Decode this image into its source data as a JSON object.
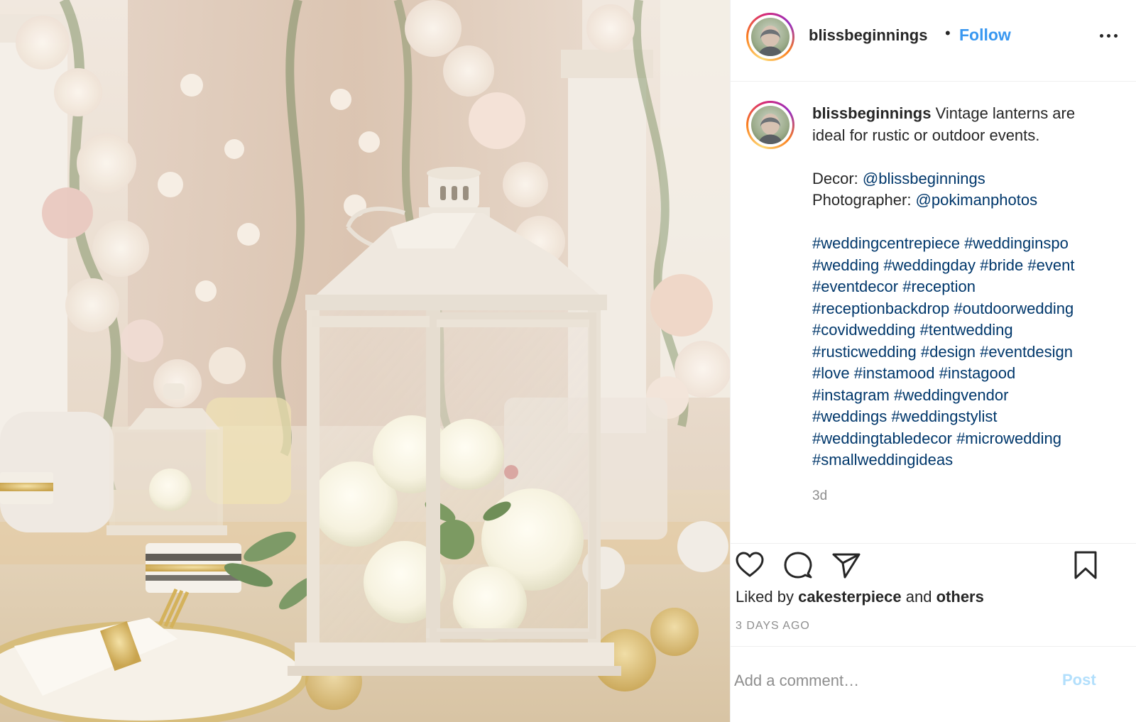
{
  "post": {
    "username": "blissbeginnings",
    "separator": "•",
    "follow_label": "Follow",
    "caption": {
      "username": "blissbeginnings",
      "lines": [
        "Vintage lanterns are",
        "ideal for rustic or outdoor events."
      ],
      "decor_label": "Decor: ",
      "decor_handle": "@blissbeginnings",
      "photographer_label": "Photographer: ",
      "photographer_handle": "@pokimanphotos",
      "hashtag_lines": [
        [
          "#weddingcentrepiece",
          "#weddinginspo"
        ],
        [
          "#wedding",
          "#weddingday",
          "#bride",
          "#event"
        ],
        [
          "#eventdecor",
          "#reception"
        ],
        [
          "#receptionbackdrop",
          "#outdoorwedding"
        ],
        [
          "#covidwedding",
          "#tentwedding"
        ],
        [
          "#rusticwedding",
          "#design",
          "#eventdesign"
        ],
        [
          "#love",
          "#instamood",
          "#instagood"
        ],
        [
          "#instagram",
          "#weddingvendor"
        ],
        [
          "#weddings",
          "#weddingstylist"
        ],
        [
          "#weddingtabledecor",
          "#microwedding"
        ],
        [
          "#smallweddingideas"
        ]
      ],
      "age": "3d"
    },
    "actions": {
      "like_icon": "heart-icon",
      "comment_icon": "comment-bubble-icon",
      "share_icon": "paper-plane-icon",
      "save_icon": "bookmark-icon"
    },
    "likes": {
      "prefix": "Liked by",
      "user": "cakesterpiece",
      "connector": "and",
      "others": "others"
    },
    "timestamp": "3 DAYS AGO",
    "comment": {
      "placeholder": "Add a comment…",
      "post_label": "Post"
    }
  },
  "colors": {
    "link": "#00376b",
    "follow": "#3897f0",
    "post_disabled": "#b2dffc",
    "muted": "#8e8e8e"
  }
}
